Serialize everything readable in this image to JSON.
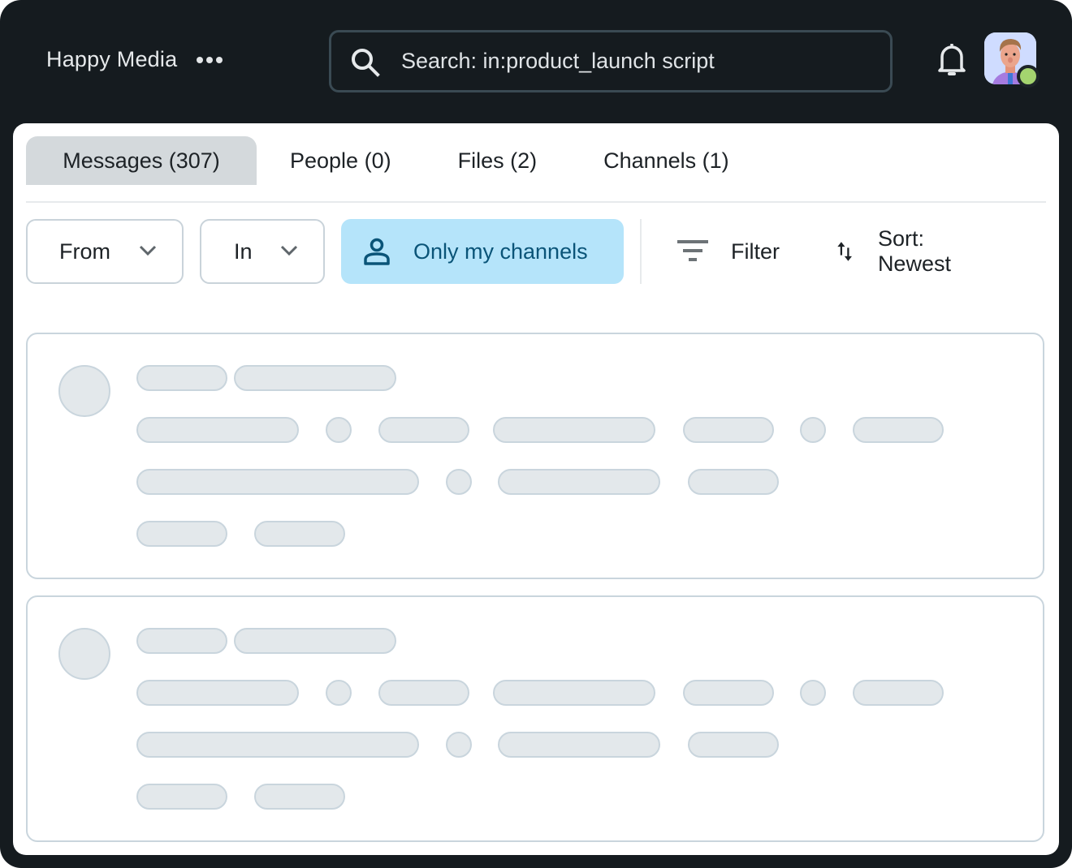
{
  "header": {
    "workspace_name": "Happy Media",
    "more_icon": "more-horizontal-icon",
    "search": {
      "icon": "search-icon",
      "value": "Search: in:product_launch script"
    },
    "notifications_icon": "bell-icon",
    "user": {
      "avatar": "user-avatar",
      "status": "online",
      "status_color": "#a4d46f"
    }
  },
  "tabs": [
    {
      "label": "Messages (307)",
      "active": true
    },
    {
      "label": "People (0)",
      "active": false
    },
    {
      "label": "Files (2)",
      "active": false
    },
    {
      "label": "Channels (1)",
      "active": false
    }
  ],
  "filters": {
    "from": {
      "label": "From",
      "icon": "chevron-down-icon"
    },
    "in": {
      "label": "In",
      "icon": "chevron-down-icon"
    },
    "only_my_channels": {
      "label": "Only my channels",
      "icon": "person-icon",
      "active": true
    },
    "filter": {
      "label": "Filter",
      "icon": "filter-icon"
    },
    "sort": {
      "label": "Sort: Newest",
      "icon": "sort-icon"
    }
  },
  "results": {
    "state": "loading",
    "skeleton_cards": 2
  },
  "colors": {
    "background_dark": "#151b1f",
    "active_tab": "#d4d9dc",
    "active_chip_bg": "#b5e4fa",
    "active_chip_text": "#0a5478",
    "skeleton_fill": "#e3e8eb",
    "skeleton_border": "#c9d5dd"
  }
}
